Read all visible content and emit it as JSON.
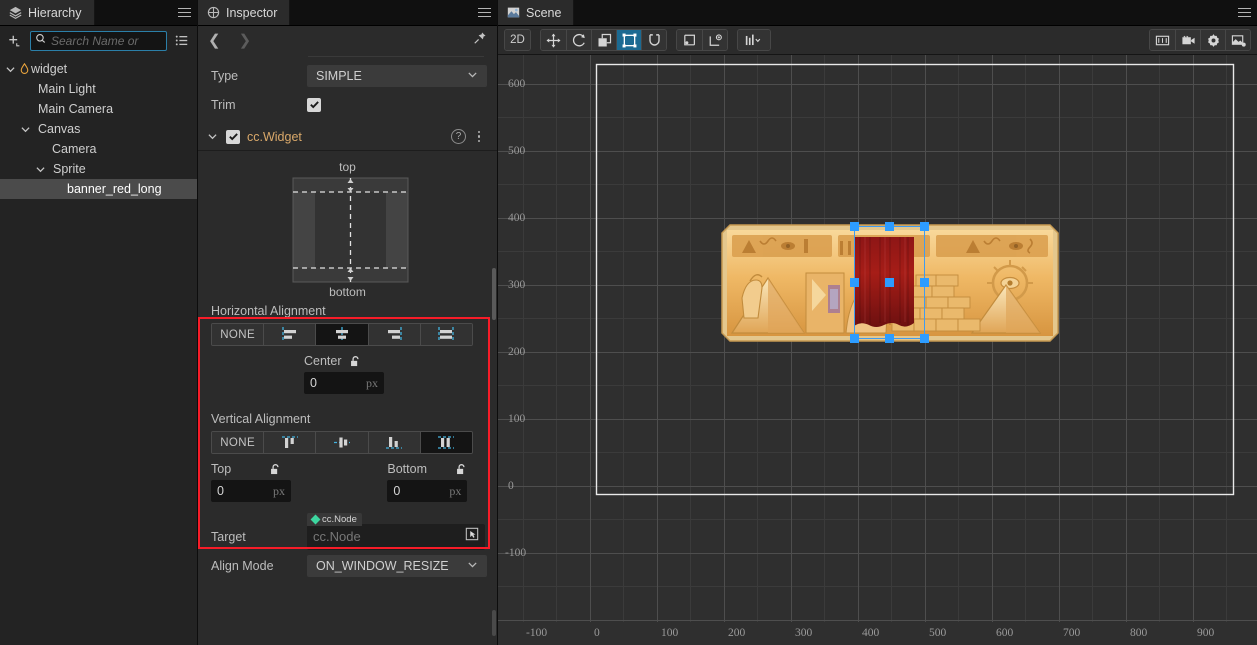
{
  "tabs": {
    "hierarchy": "Hierarchy",
    "inspector": "Inspector",
    "scene": "Scene"
  },
  "hierarchy": {
    "search_placeholder": "Search Name or",
    "nodes": [
      {
        "label": "widget",
        "depth": 0,
        "expandable": true,
        "expanded": true,
        "icon": "prefab-icon",
        "selected": false
      },
      {
        "label": "Main Light",
        "depth": 1,
        "expandable": false,
        "expanded": false,
        "icon": "",
        "selected": false
      },
      {
        "label": "Main Camera",
        "depth": 1,
        "expandable": false,
        "expanded": false,
        "icon": "",
        "selected": false
      },
      {
        "label": "Canvas",
        "depth": 1,
        "expandable": true,
        "expanded": true,
        "icon": "",
        "selected": false
      },
      {
        "label": "Camera",
        "depth": 2,
        "expandable": false,
        "expanded": false,
        "icon": "",
        "selected": false
      },
      {
        "label": "Sprite",
        "depth": 2,
        "expandable": true,
        "expanded": true,
        "icon": "",
        "selected": false
      },
      {
        "label": "banner_red_long",
        "depth": 3,
        "expandable": false,
        "expanded": false,
        "icon": "",
        "selected": true
      }
    ]
  },
  "inspector": {
    "type_label": "Type",
    "type_value": "SIMPLE",
    "trim_label": "Trim",
    "trim_checked": true,
    "component": {
      "name": "cc.Widget",
      "enabled": true
    },
    "diagram": {
      "top_label": "top",
      "bottom_label": "bottom"
    },
    "horizontal": {
      "title": "Horizontal Alignment",
      "options": [
        "NONE",
        "align-left",
        "align-center-h",
        "align-right",
        "align-stretch-h"
      ],
      "selected_index": 2,
      "field_label": "Center",
      "field_value": "0",
      "field_unit": "px",
      "locked": false
    },
    "vertical": {
      "title": "Vertical Alignment",
      "options": [
        "NONE",
        "align-top",
        "align-center-v",
        "align-bottom",
        "align-stretch-v"
      ],
      "selected_index": 4,
      "fields": [
        {
          "label": "Top",
          "value": "0",
          "unit": "px",
          "locked": false
        },
        {
          "label": "Bottom",
          "value": "0",
          "unit": "px",
          "locked": false
        }
      ]
    },
    "target": {
      "label": "Target",
      "tag": "cc.Node",
      "placeholder": "cc.Node"
    },
    "align_mode": {
      "label": "Align Mode",
      "value": "ON_WINDOW_RESIZE"
    },
    "highlight_color": "#f71c28"
  },
  "scene": {
    "toolbar": {
      "mode_2d": "2D",
      "transform_tools": [
        "move-icon",
        "rotate-icon",
        "scale-icon",
        "rect-transform-icon",
        "magnet-icon"
      ],
      "transform_selected_index": 3,
      "pivot_tools": [
        "pivot-icon",
        "coordinate-icon"
      ],
      "gizmo_tools": [
        "gizmo-effects-icon"
      ],
      "right_tools": [
        "camera-preview-icon",
        "camera-icon",
        "gear-icon",
        "screenshot-icon"
      ]
    },
    "ruler": {
      "vertical_ticks": [
        "600",
        "500",
        "400",
        "300",
        "200",
        "100",
        "0",
        "-100"
      ],
      "horizontal_ticks": [
        "-100",
        "0",
        "100",
        "200",
        "300",
        "400",
        "500",
        "600",
        "700",
        "800",
        "900"
      ]
    },
    "selection": {
      "handle_color": "#2d9cff"
    }
  }
}
